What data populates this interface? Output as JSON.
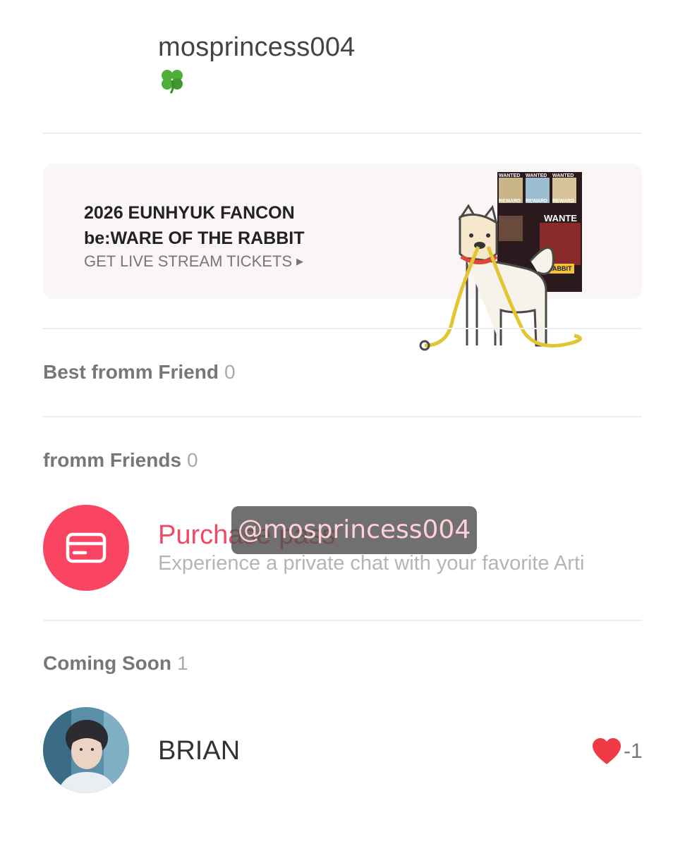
{
  "profile": {
    "username": "mosprincess004",
    "status_icon": "four-leaf-clover-icon"
  },
  "banner": {
    "title_line1": "2026 EUNHYUK FANCON",
    "title_line2": "be:WARE OF THE RABBIT",
    "cta": "GET LIVE STREAM TICKETS",
    "poster": {
      "wanted": "WANTED",
      "reward": "REWARD",
      "wanted_big": "WANTE",
      "rabbit": "E RABBIT"
    }
  },
  "sections": {
    "best_friend": {
      "title": "Best fromm Friend",
      "count": "0"
    },
    "friends": {
      "title": "fromm Friends",
      "count": "0"
    },
    "coming_soon": {
      "title": "Coming Soon",
      "count": "1"
    }
  },
  "purchase": {
    "title": "Purchase pass",
    "subtitle": "Experience a private chat with your favorite Arti",
    "icon": "card-icon"
  },
  "watermark": "@mosprincess004",
  "artist": {
    "name": "BRIAN",
    "like_count": "-1",
    "heart_color": "#f03a46"
  },
  "colors": {
    "accent": "#f94562",
    "divider": "#eeeeee",
    "banner_bg": "#faf6f6"
  }
}
